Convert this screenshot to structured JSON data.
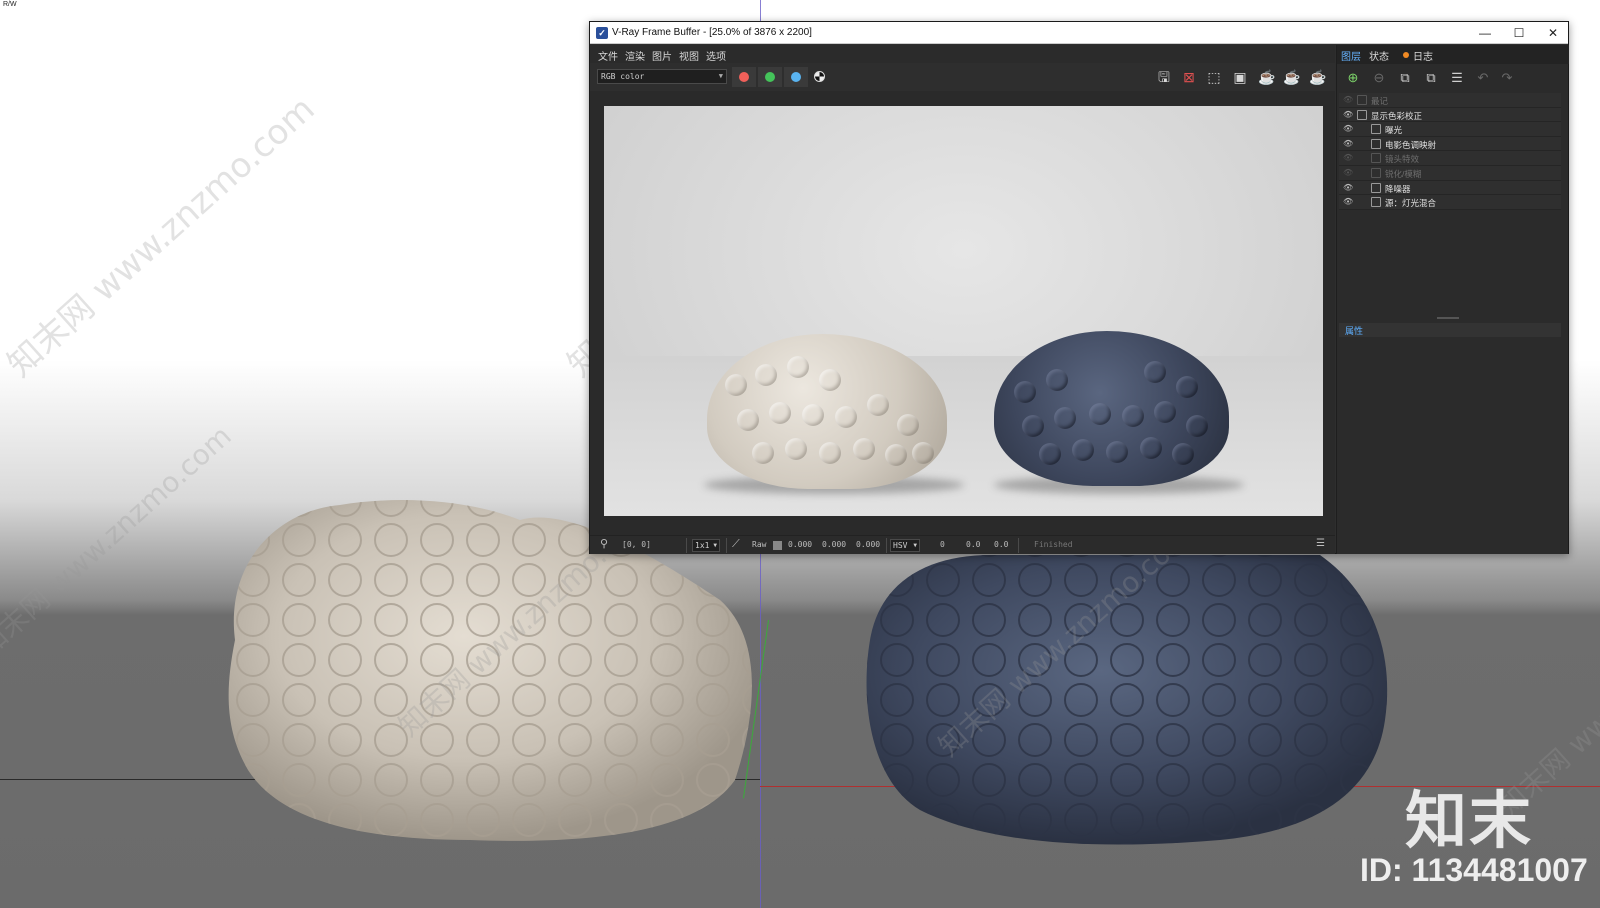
{
  "viewport": {
    "corner_label": "R/W",
    "watermark": "知末网 www.znzmo.com",
    "brand": "知末",
    "brand_id": "ID: 1134481007"
  },
  "window": {
    "title": "V-Ray Frame Buffer - [25.0% of 3876 x 2200]",
    "minimize_glyph": "—",
    "maximize_glyph": "☐",
    "close_glyph": "✕"
  },
  "menu": {
    "items": [
      "文件",
      "渲染",
      "图片",
      "视图",
      "选项"
    ]
  },
  "toolbar": {
    "channel_value": "RGB color",
    "channel_colors": {
      "red": "#f0605a",
      "green": "#44c45a",
      "blue": "#5ab4f0"
    },
    "icons": [
      "save-icon",
      "clear-image-icon",
      "region-render-icon",
      "track-mouse-icon",
      "interactive-render-icon",
      "stop-render-icon",
      "render-teapot-icon"
    ]
  },
  "statusbar": {
    "coords": "[0, 0]",
    "zoom": "1x1",
    "raw_label": "Raw",
    "rgb_values": [
      "0.000",
      "0.000",
      "0.000"
    ],
    "color_mode": "HSV",
    "hsv_values": [
      "0",
      "0.0",
      "0.0"
    ],
    "status_text": "Finished"
  },
  "panel": {
    "tabs": [
      "图层",
      "状态",
      "日志"
    ],
    "active_tab": "图层",
    "log_dot_color": "#f08a24",
    "layers": [
      {
        "name": "最记",
        "visible": false,
        "disabled": true,
        "indent": 0
      },
      {
        "name": "显示色彩校正",
        "visible": true,
        "disabled": false,
        "indent": 0
      },
      {
        "name": "曝光",
        "visible": true,
        "disabled": false,
        "indent": 1
      },
      {
        "name": "电影色调映射",
        "visible": true,
        "disabled": false,
        "indent": 1
      },
      {
        "name": "镜头特效",
        "visible": false,
        "disabled": true,
        "indent": 1
      },
      {
        "name": "锐化/模糊",
        "visible": false,
        "disabled": true,
        "indent": 1
      },
      {
        "name": "降噪器",
        "visible": true,
        "disabled": false,
        "indent": 1
      },
      {
        "name": "源：灯光混合",
        "visible": true,
        "disabled": false,
        "indent": 1
      }
    ],
    "properties_label": "属性"
  }
}
